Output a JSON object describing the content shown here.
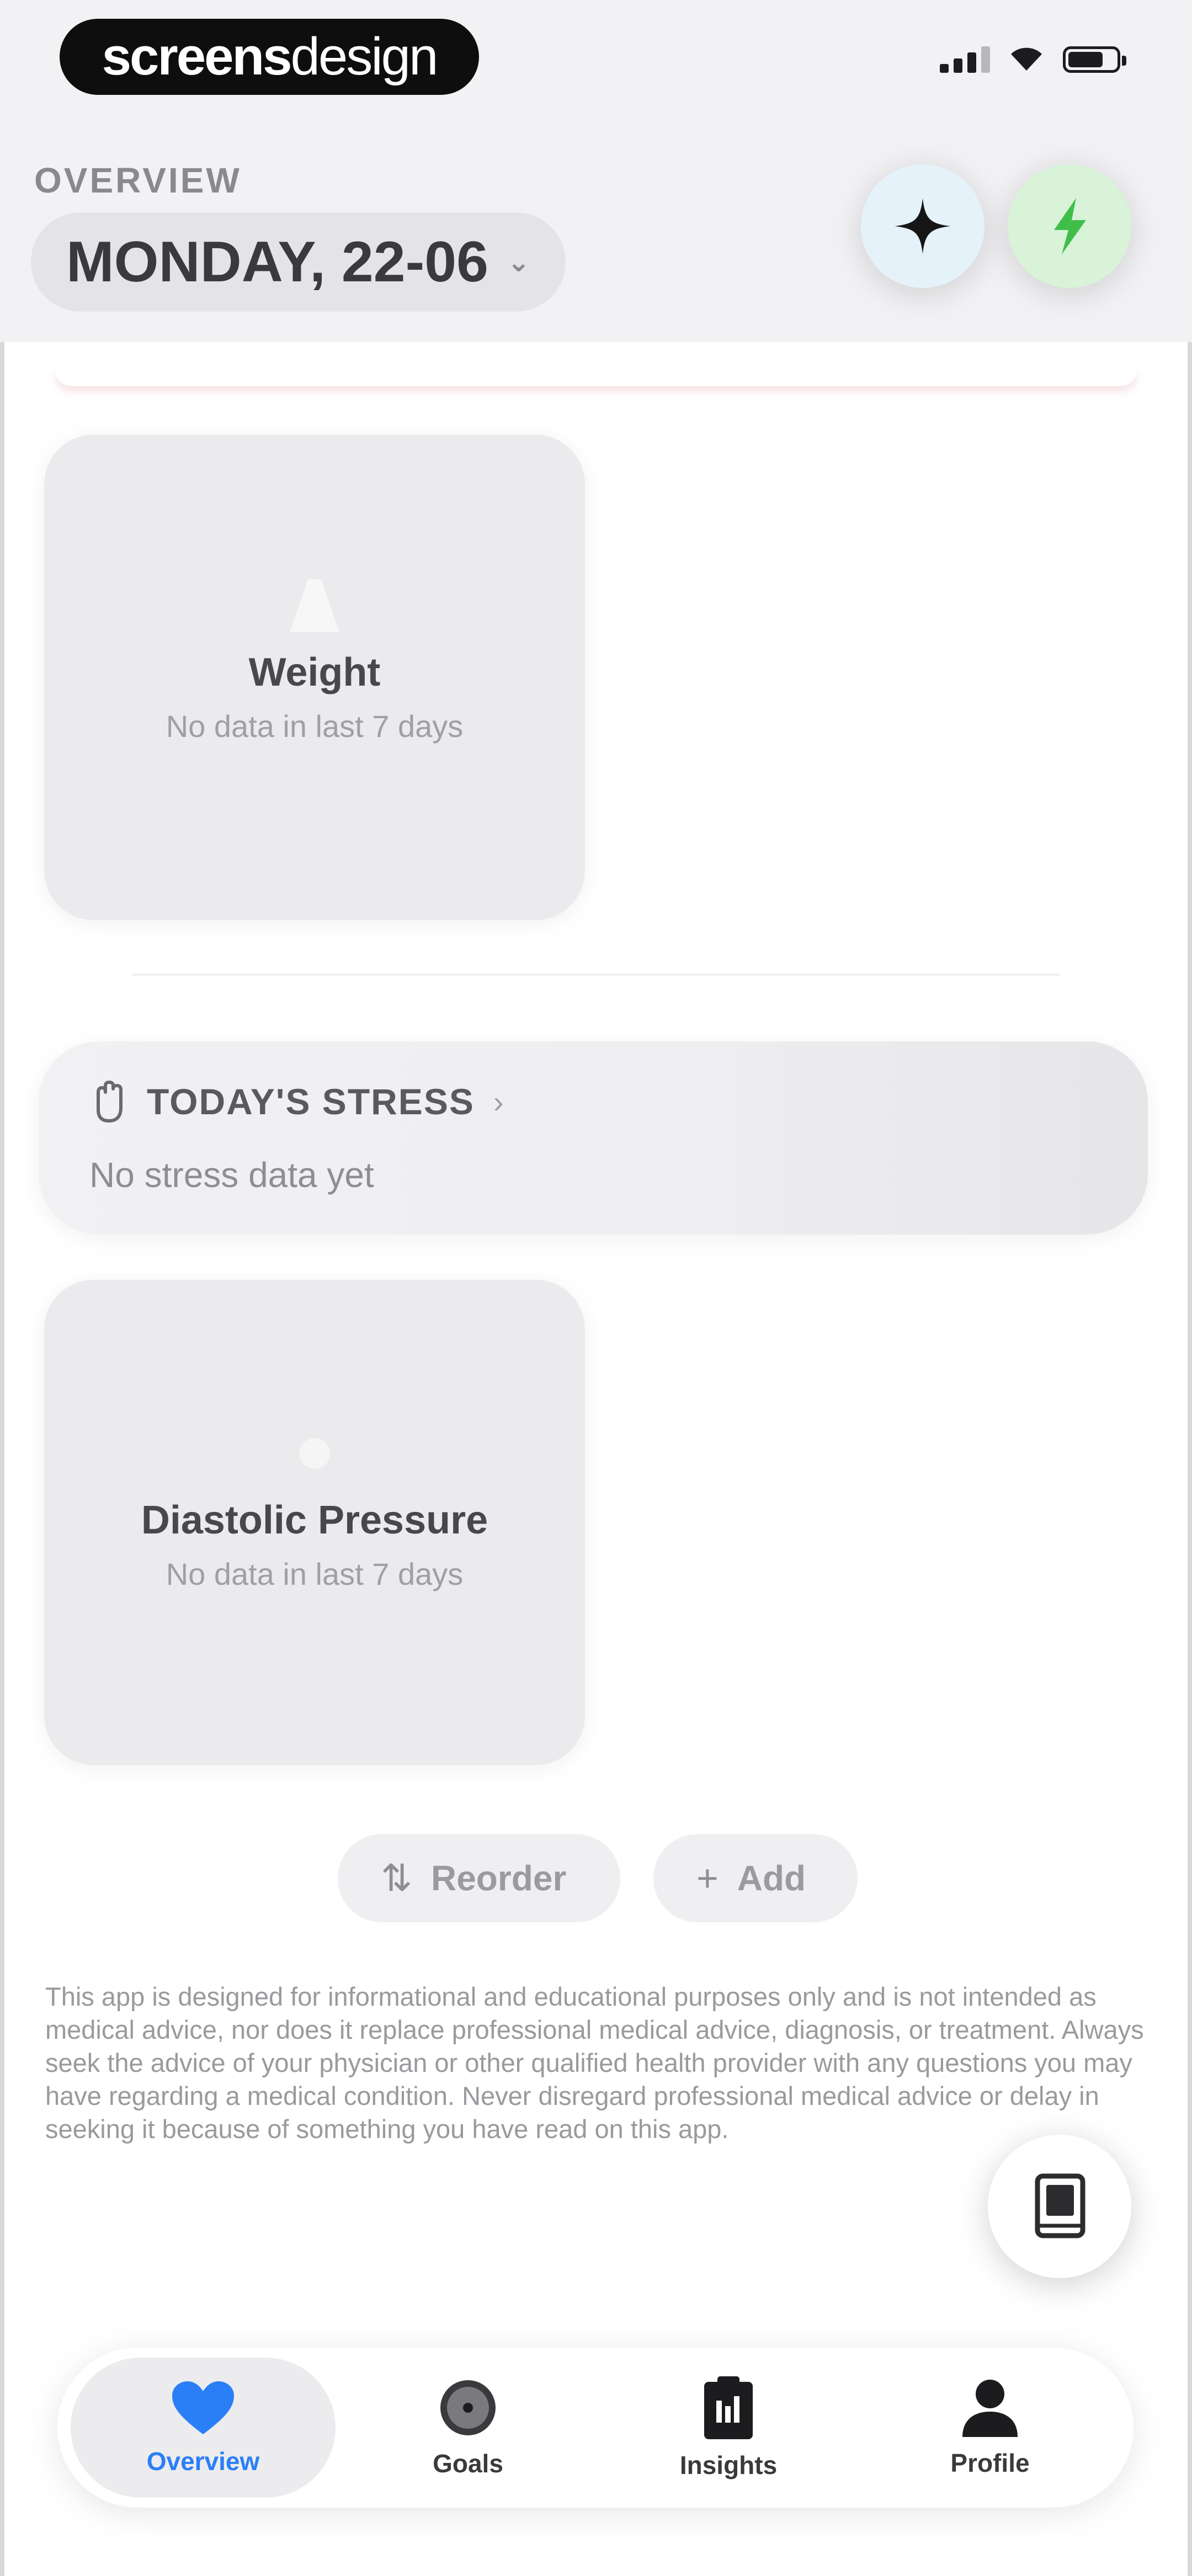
{
  "header": {
    "brand_bold": "screens",
    "brand_light": "design",
    "section_label": "OVERVIEW",
    "date": "MONDAY, 22-06"
  },
  "cards": {
    "weight": {
      "title": "Weight",
      "subtitle": "No data in last 7 days"
    },
    "stress": {
      "title": "TODAY'S STRESS",
      "subtitle": "No stress data yet"
    },
    "diastolic": {
      "title": "Diastolic Pressure",
      "subtitle": "No data in last 7 days"
    }
  },
  "actions": {
    "reorder": "Reorder",
    "add": "Add"
  },
  "disclaimer": "This app is designed for informational and educational purposes only and is not intended as medical advice, nor does it replace professional medical advice, diagnosis, or treatment. Always seek the advice of your physician or other qualified health provider with any questions you may have regarding a medical condition. Never disregard professional medical advice or delay in seeking it because of something you have read on this app.",
  "tabs": [
    {
      "label": "Overview",
      "icon": "heart-icon",
      "active": true
    },
    {
      "label": "Goals",
      "icon": "target-icon",
      "active": false
    },
    {
      "label": "Insights",
      "icon": "clipboard-icon",
      "active": false
    },
    {
      "label": "Profile",
      "icon": "person-icon",
      "active": false
    }
  ],
  "colors": {
    "accent": "#2a7ff7",
    "sparkle_bg": "#e6f2fa",
    "bolt_bg": "#d8f3d8",
    "bolt": "#3fbf4a"
  }
}
